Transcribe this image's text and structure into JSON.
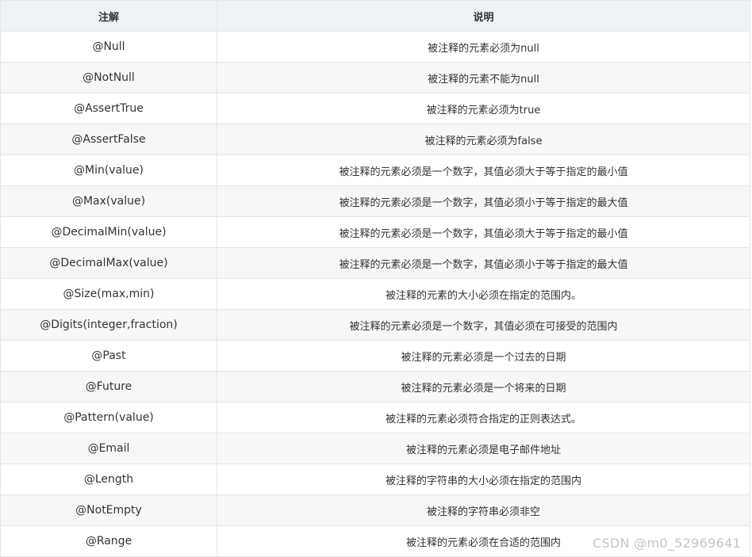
{
  "table": {
    "headers": [
      "注解",
      "说明"
    ],
    "rows": [
      {
        "annotation": "@Null",
        "description": "被注释的元素必须为null"
      },
      {
        "annotation": "@NotNull",
        "description": "被注释的元素不能为null"
      },
      {
        "annotation": "@AssertTrue",
        "description": "被注释的元素必须为true"
      },
      {
        "annotation": "@AssertFalse",
        "description": "被注释的元素必须为false"
      },
      {
        "annotation": "@Min(value)",
        "description": "被注释的元素必须是一个数字，其值必须大于等于指定的最小值"
      },
      {
        "annotation": "@Max(value)",
        "description": "被注释的元素必须是一个数字，其值必须小于等于指定的最大值"
      },
      {
        "annotation": "@DecimalMin(value)",
        "description": "被注释的元素必须是一个数字，其值必须大于等于指定的最小值"
      },
      {
        "annotation": "@DecimalMax(value)",
        "description": "被注释的元素必须是一个数字，其值必须小于等于指定的最大值"
      },
      {
        "annotation": "@Size(max,min)",
        "description": "被注释的元素的大小必须在指定的范围内。"
      },
      {
        "annotation": "@Digits(integer,fraction)",
        "description": "被注释的元素必须是一个数字，其值必须在可接受的范围内"
      },
      {
        "annotation": "@Past",
        "description": "被注释的元素必须是一个过去的日期"
      },
      {
        "annotation": "@Future",
        "description": "被注释的元素必须是一个将来的日期"
      },
      {
        "annotation": "@Pattern(value)",
        "description": "被注释的元素必须符合指定的正则表达式。"
      },
      {
        "annotation": "@Email",
        "description": "被注释的元素必须是电子邮件地址"
      },
      {
        "annotation": "@Length",
        "description": "被注释的字符串的大小必须在指定的范围内"
      },
      {
        "annotation": "@NotEmpty",
        "description": "被注释的字符串必须非空"
      },
      {
        "annotation": "@Range",
        "description": "被注释的元素必须在合适的范围内"
      }
    ]
  },
  "watermark": "CSDN @m0_52969641"
}
